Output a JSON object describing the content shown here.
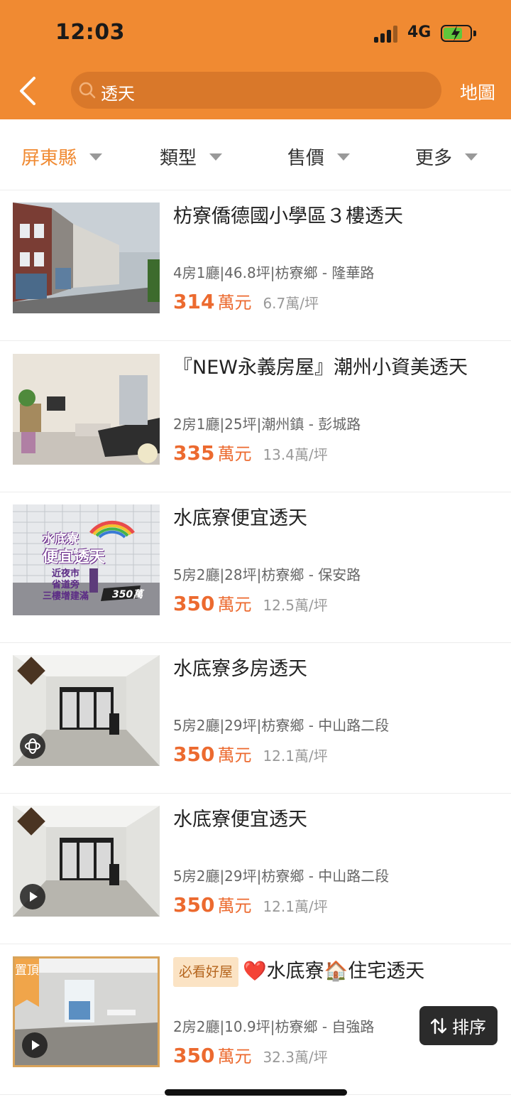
{
  "status_bar": {
    "time": "12:03",
    "network": "4G"
  },
  "search": {
    "query": "透天",
    "map_label": "地圖"
  },
  "filters": [
    {
      "label": "屏東縣",
      "active": true
    },
    {
      "label": "類型",
      "active": false
    },
    {
      "label": "售價",
      "active": false
    },
    {
      "label": "更多",
      "active": false
    }
  ],
  "listings": [
    {
      "title": "枋寮僑德國小學區３樓透天",
      "specs": "4房1廳|46.8坪|枋寮鄉 - 隆華路",
      "price": "314",
      "price_unit": "萬元",
      "per_ping": "6.7萬/坪"
    },
    {
      "title": "『NEW永義房屋』潮州小資美透天",
      "specs": "2房1廳|25坪|潮州鎮 - 彭城路",
      "price": "335",
      "price_unit": "萬元",
      "per_ping": "13.4萬/坪"
    },
    {
      "title": "水底寮便宜透天",
      "specs": "5房2廳|28坪|枋寮鄉 - 保安路",
      "price": "350",
      "price_unit": "萬元",
      "per_ping": "12.5萬/坪",
      "thumb_text": {
        "line1": "水底寮",
        "line2": "便宜透天",
        "line3": "近夜市",
        "line4": "省道旁",
        "line5": "三樓增建滿",
        "price_tag": "350萬"
      }
    },
    {
      "title": "水底寮多房透天",
      "specs": "5房2廳|29坪|枋寮鄉 - 中山路二段",
      "price": "350",
      "price_unit": "萬元",
      "per_ping": "12.1萬/坪"
    },
    {
      "title": "水底寮便宜透天",
      "specs": "5房2廳|29坪|枋寮鄉 - 中山路二段",
      "price": "350",
      "price_unit": "萬元",
      "per_ping": "12.1萬/坪"
    },
    {
      "badge": "必看好屋",
      "title": "❤️水底寮🏠住宅透天",
      "specs": "2房2廳|10.9坪|枋寮鄉 - 自強路",
      "price": "350",
      "price_unit": "萬元",
      "per_ping": "32.3萬/坪",
      "pinned_label": "置頂"
    }
  ],
  "sort": {
    "label": "排序"
  },
  "colors": {
    "brand": "#f08a32",
    "price": "#ec6a2f"
  }
}
